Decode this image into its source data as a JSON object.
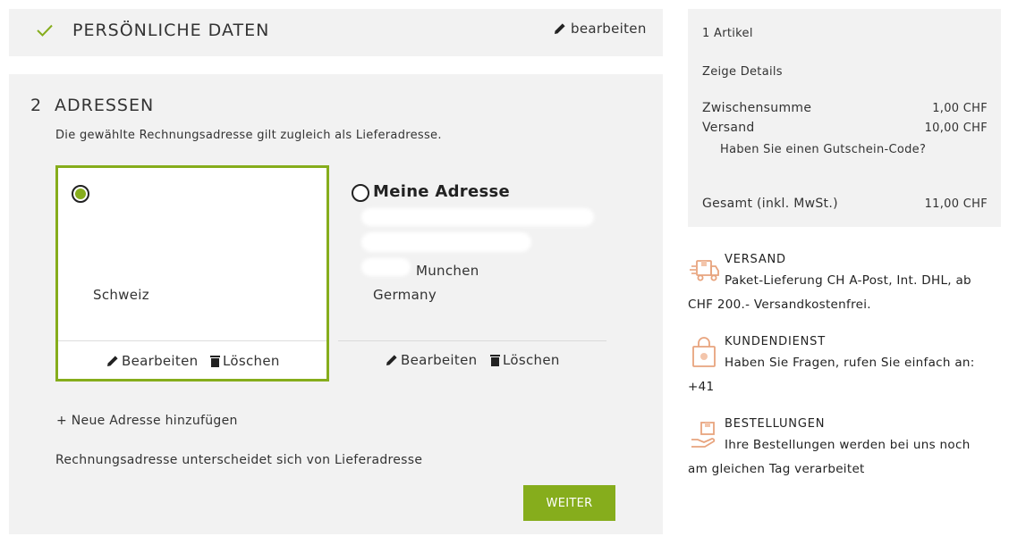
{
  "colors": {
    "accent": "#86ad1c",
    "panel": "#f2f2f2",
    "icon_orange": "#e8a47e"
  },
  "personal": {
    "title": "PERSÖNLICHE DATEN",
    "edit_label": "bearbeiten",
    "status_icon": "check-icon"
  },
  "addresses": {
    "step_number": "2",
    "title": "ADRESSEN",
    "hint": "Die gewählte Rechnungsadresse gilt zugleich als Lieferadresse.",
    "cards": [
      {
        "name": "",
        "city": "",
        "country": "Schweiz",
        "selected": true,
        "edit_label": "Bearbeiten",
        "delete_label": "Löschen"
      },
      {
        "name": "Meine Adresse",
        "city": "Munchen",
        "country": "Germany",
        "selected": false,
        "edit_label": "Bearbeiten",
        "delete_label": "Löschen"
      }
    ],
    "add_new": "+ Neue Adresse hinzufügen",
    "different_billing": "Rechnungsadresse unterscheidet sich von Lieferadresse",
    "next_button": "WEITER"
  },
  "summary": {
    "items_count": "1 Artikel",
    "show_details": "Zeige Details",
    "subtotal_label": "Zwischensumme",
    "subtotal_value": "1,00 CHF",
    "shipping_label": "Versand",
    "shipping_value": "10,00 CHF",
    "coupon_link": "Haben Sie einen Gutschein-Code?",
    "total_label": "Gesamt (inkl. MwSt.)",
    "total_value": "11,00 CHF"
  },
  "services": [
    {
      "icon": "delivery-truck-icon",
      "title": "VERSAND",
      "text": "Paket-Lieferung CH A-Post, Int. DHL, ab CHF 200.- Versandkostenfrei."
    },
    {
      "icon": "shopping-bag-icon",
      "title": "KUNDENDIENST",
      "text": "Haben Sie Fragen, rufen Sie einfach an: +41"
    },
    {
      "icon": "package-hand-icon",
      "title": "BESTELLUNGEN",
      "text": "Ihre Bestellungen werden bei uns noch am gleichen Tag verarbeitet"
    }
  ]
}
